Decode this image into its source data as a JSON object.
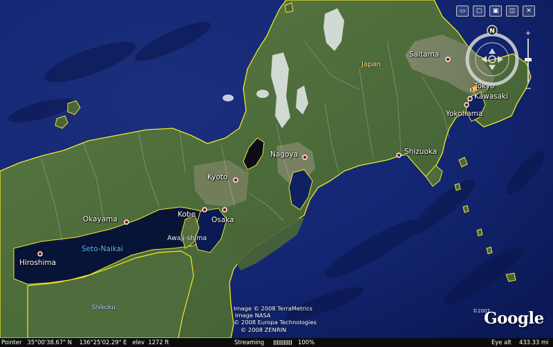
{
  "places": {
    "saitama": "Saitama",
    "japan": "Japan",
    "tokyo": "Tokyo",
    "kawasaki": "Kawasaki",
    "yokohama": "Yokohama",
    "nagoya": "Nagoya",
    "shizuoka": "Shizuoka",
    "kyoto": "Kyoto",
    "kobe": "Kobe",
    "osaka": "Osaka",
    "okayama": "Okayama",
    "hiroshima": "Hiroshima",
    "seto_naikai": "Seto-Naikai",
    "awaji_shima": "Awaji-shima",
    "shikoku": "Shikoku"
  },
  "attribution": {
    "line1": "Image © 2008 TerraMetrics",
    "line2": "Image NASA",
    "line3": "© 2008 Europa Technologies",
    "line4": "© 2008 ZENRIN"
  },
  "brand": {
    "copyright_year": "©2007",
    "logo_text": "Google"
  },
  "nav": {
    "north_label": "N"
  },
  "status_bar": {
    "pointer": "Pointer   35°00'38.67\" N    136°25'02.29\" E   elev  1272 ft",
    "streaming": "Streaming",
    "streaming_percent": "100%",
    "eye_alt_label": "Eye alt",
    "eye_alt_value": "433.33 mi"
  },
  "colors": {
    "ocean": "#13266e",
    "land": "#4d6a3a",
    "coastline": "#f2e92a",
    "city_marker": "#8a1010"
  }
}
